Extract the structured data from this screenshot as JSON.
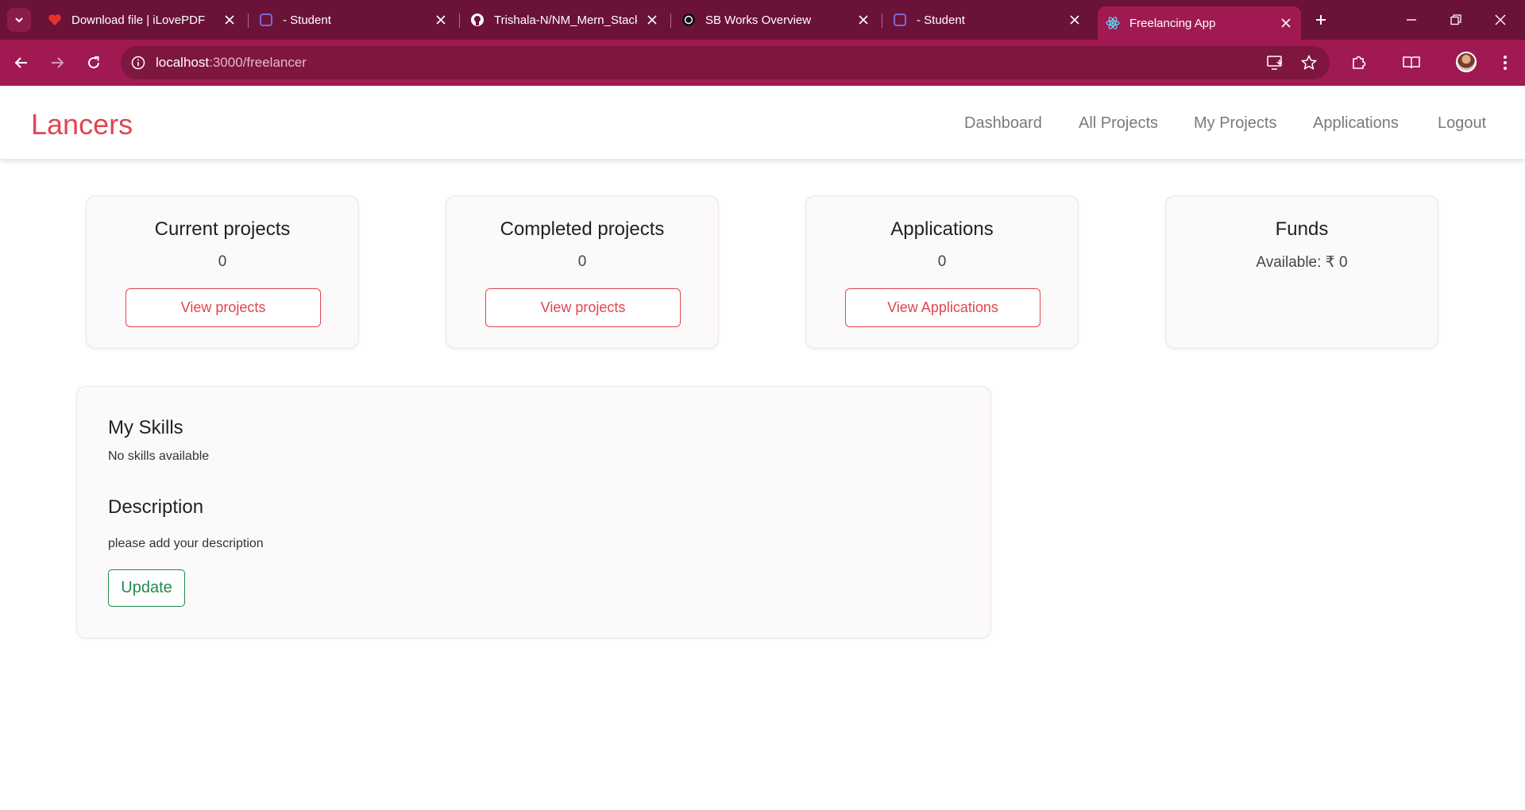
{
  "browser": {
    "tabs": [
      {
        "title": "Download file | iLovePDF",
        "icon": "ilovepdf-heart-icon"
      },
      {
        "title": "- Student",
        "icon": "student-app-icon"
      },
      {
        "title": "Trishala-N/NM_Mern_Stack",
        "icon": "github-icon"
      },
      {
        "title": "SB Works Overview",
        "icon": "openai-icon"
      },
      {
        "title": "- Student",
        "icon": "student-app-icon"
      },
      {
        "title": "Freelancing App",
        "icon": "react-icon",
        "active": true
      }
    ],
    "url_host": "localhost",
    "url_path": ":3000/freelancer"
  },
  "app": {
    "brand": "Lancers",
    "nav": [
      "Dashboard",
      "All Projects",
      "My Projects",
      "Applications",
      "Logout"
    ]
  },
  "cards": [
    {
      "title": "Current projects",
      "value": "0",
      "button": "View projects"
    },
    {
      "title": "Completed projects",
      "value": "0",
      "button": "View projects"
    },
    {
      "title": "Applications",
      "value": "0",
      "button": "View Applications"
    },
    {
      "title": "Funds",
      "value": "Available: ₹ 0"
    }
  ],
  "profile": {
    "skills_heading": "My Skills",
    "skills_text": "No skills available",
    "description_heading": "Description",
    "description_text": "please add your description",
    "update_label": "Update"
  },
  "colors": {
    "tabstrip": "#6b1238",
    "toolbar": "#a11952",
    "brand": "#e0454f",
    "update": "#1e8a4f"
  }
}
